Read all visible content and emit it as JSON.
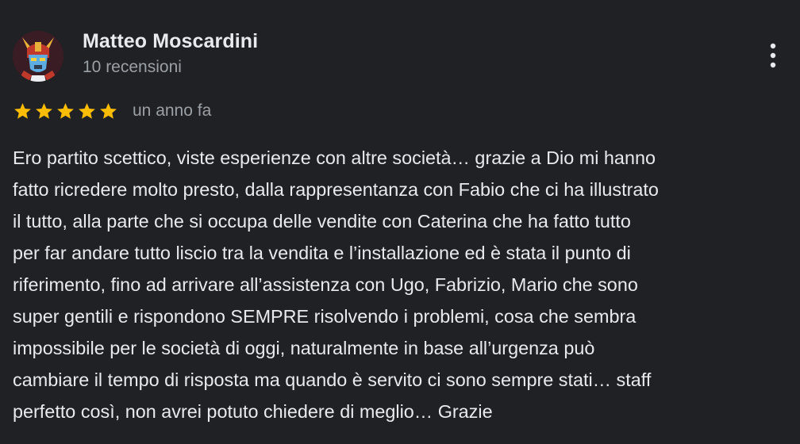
{
  "review": {
    "author": {
      "name": "Matteo Moscardini",
      "meta": "10 recensioni",
      "avatar_icon": "robot-avatar-icon"
    },
    "rating": {
      "stars": 5,
      "max": 5,
      "star_color": "#fbbc04"
    },
    "date": "un anno fa",
    "more_icon": "more-vert-icon",
    "text_lines": [
      "Ero partito scettico, viste esperienze con altre società… grazie a Dio mi hanno",
      "fatto ricredere molto presto, dalla rappresentanza con Fabio che ci ha illustrato",
      "il tutto, alla parte che si occupa delle vendite con Caterina che ha fatto tutto",
      "per far andare tutto liscio tra la vendita e l’installazione ed è stata il punto di",
      "riferimento, fino ad arrivare all’assistenza con Ugo, Fabrizio, Mario che sono",
      "super gentili e rispondono SEMPRE risolvendo i problemi, cosa che sembra",
      "impossibile per le società di oggi, naturalmente in base all’urgenza può",
      "cambiare il tempo di risposta ma quando è servito ci sono sempre stati… staff",
      "perfetto così, non avrei potuto chiedere di meglio… Grazie"
    ]
  }
}
